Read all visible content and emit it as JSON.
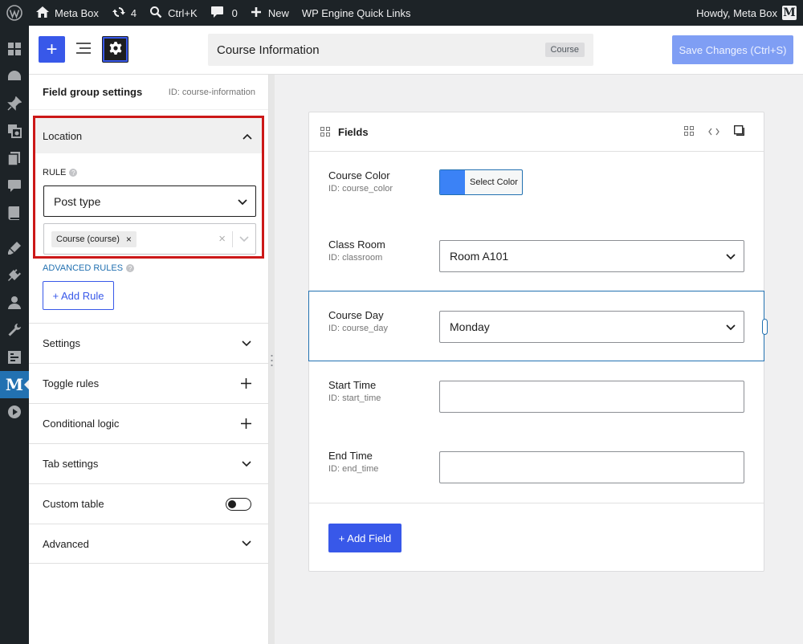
{
  "admin_bar": {
    "site_name": "Meta Box",
    "updates_count": "4",
    "command_shortcut": "Ctrl+K",
    "comments_count": "0",
    "new_label": "New",
    "wp_engine_label": "WP Engine Quick Links",
    "howdy": "Howdy, Meta Box",
    "avatar_letter": "M"
  },
  "admin_menu": {
    "items": [
      "dashboard-icon",
      "gauge-icon",
      "pin-icon",
      "media-icon",
      "pages-icon",
      "comments-icon",
      "book-icon",
      "appearance-icon",
      "plugins-icon",
      "users-icon",
      "tools-icon",
      "settings-icon",
      "meta-box-icon",
      "play-icon"
    ],
    "metabox_letter": "M"
  },
  "toolbar": {
    "add_label": "+",
    "title": "Course Information",
    "post_type_badge": "Course",
    "save_label": "Save Changes (Ctrl+S)"
  },
  "sidebar": {
    "title": "Field group settings",
    "id_text": "ID: course-information",
    "location": {
      "title": "Location",
      "rule_label": "RULE",
      "rule_value": "Post type",
      "chip_label": "Course (course)",
      "chip_remove": "×",
      "clear_label": "×",
      "advanced_rules_label": "ADVANCED RULES",
      "add_rule_label": "+ Add Rule"
    },
    "sections": [
      {
        "label": "Settings",
        "control": "chevron"
      },
      {
        "label": "Toggle rules",
        "control": "plus"
      },
      {
        "label": "Conditional logic",
        "control": "plus"
      },
      {
        "label": "Tab settings",
        "control": "chevron"
      },
      {
        "label": "Custom table",
        "control": "toggle"
      },
      {
        "label": "Advanced",
        "control": "chevron"
      }
    ]
  },
  "fields_panel": {
    "title": "Fields",
    "fields": [
      {
        "label": "Course Color",
        "id_text": "ID: course_color",
        "type": "color",
        "button_label": "Select Color",
        "swatch_color": "#3b82f6"
      },
      {
        "label": "Class Room",
        "id_text": "ID: classroom",
        "type": "select",
        "value": "Room A101"
      },
      {
        "label": "Course Day",
        "id_text": "ID: course_day",
        "type": "select",
        "value": "Monday",
        "selected": true
      },
      {
        "label": "Start Time",
        "id_text": "ID: start_time",
        "type": "text",
        "value": ""
      },
      {
        "label": "End Time",
        "id_text": "ID: end_time",
        "type": "text",
        "value": ""
      }
    ],
    "add_field_label": "+ Add Field"
  },
  "colors": {
    "accent": "#3858e9",
    "highlight_border": "#cc1818",
    "admin_dark": "#1d2327"
  }
}
